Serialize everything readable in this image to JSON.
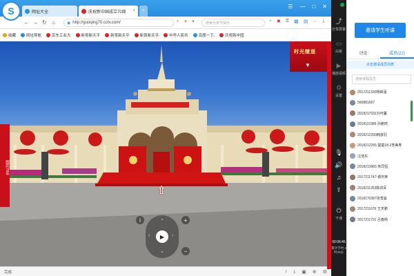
{
  "browser": {
    "logo": "S",
    "tabs": [
      {
        "label": "网址大全"
      },
      {
        "label": "庆祝新中国成立70周"
      }
    ],
    "new_tab": "+",
    "window_controls": [
      "☰",
      "—",
      "□",
      "✕"
    ],
    "address": "http://guoqing70.cctv.com/",
    "search_placeholder": "搜索元宵节快乐",
    "bookmarks": [
      {
        "label": "收藏",
        "color": "#888888"
      },
      {
        "label": "网址导航",
        "color": "#2b8ee0"
      },
      {
        "label": "京东工业大",
        "color": "#d22222"
      },
      {
        "label": "新育新天乎",
        "color": "#d22222"
      },
      {
        "label": "新育新天乎",
        "color": "#d22222"
      },
      {
        "label": "新育新天乎",
        "color": "#d22222"
      },
      {
        "label": "中华人民共",
        "color": "#d22222"
      },
      {
        "label": "百度一下,",
        "color": "#2b8ee0"
      },
      {
        "label": "庆祝新中国",
        "color": "#d22222"
      }
    ],
    "status_text": "完成"
  },
  "pano": {
    "side_label": "国庆70年",
    "banner_text": "时光隧道",
    "banner_down": "▼",
    "up_arrow": "⇧",
    "zoom_in": "+",
    "zoom_out": "−",
    "info": "i"
  },
  "dock": {
    "items": [
      {
        "label": "分享屏幕"
      },
      {
        "label": "白板"
      },
      {
        "label": "播放视频"
      },
      {
        "label": "设置"
      },
      {
        "label": "下课"
      }
    ],
    "timer": "00:06:45",
    "timer_sub": "累计学时 2时39分"
  },
  "panel": {
    "apply_label": "邀请学生听课",
    "tabs": [
      "讨论",
      "成员(22)"
    ],
    "member_link": "点击邀请成员列表",
    "search_placeholder": "搜索课程成员",
    "members": [
      {
        "name": "2017211330杨锦涵",
        "color": "#b08a6a"
      },
      {
        "name": "566881667",
        "color": "#7c8c9a"
      },
      {
        "name": "2018217031刘可馨",
        "color": "#9c7a6a"
      },
      {
        "name": "2018110389 孙鹏鸣",
        "color": "#6a7a9c"
      },
      {
        "name": "2018212250韩淑羽",
        "color": "#aa8877"
      },
      {
        "name": "2018212255 楚楚18-2李美寿",
        "color": "#c59a7a"
      },
      {
        "name": "汪浩东",
        "color": "#9aa4b0"
      },
      {
        "name": "2018213965 朱同恒",
        "color": "#7a8899"
      },
      {
        "name": "2017211747-谢庆荣",
        "color": "#8a7a6a"
      },
      {
        "name": "2018211353陈双军",
        "color": "#a08070"
      },
      {
        "name": "2018170387张雪淼",
        "color": "#6f8a9a"
      },
      {
        "name": "2017211676 王天鹏",
        "color": "#9a8a7a"
      },
      {
        "name": "2017211731 吕春杨",
        "color": "#7a7a8a"
      }
    ]
  }
}
